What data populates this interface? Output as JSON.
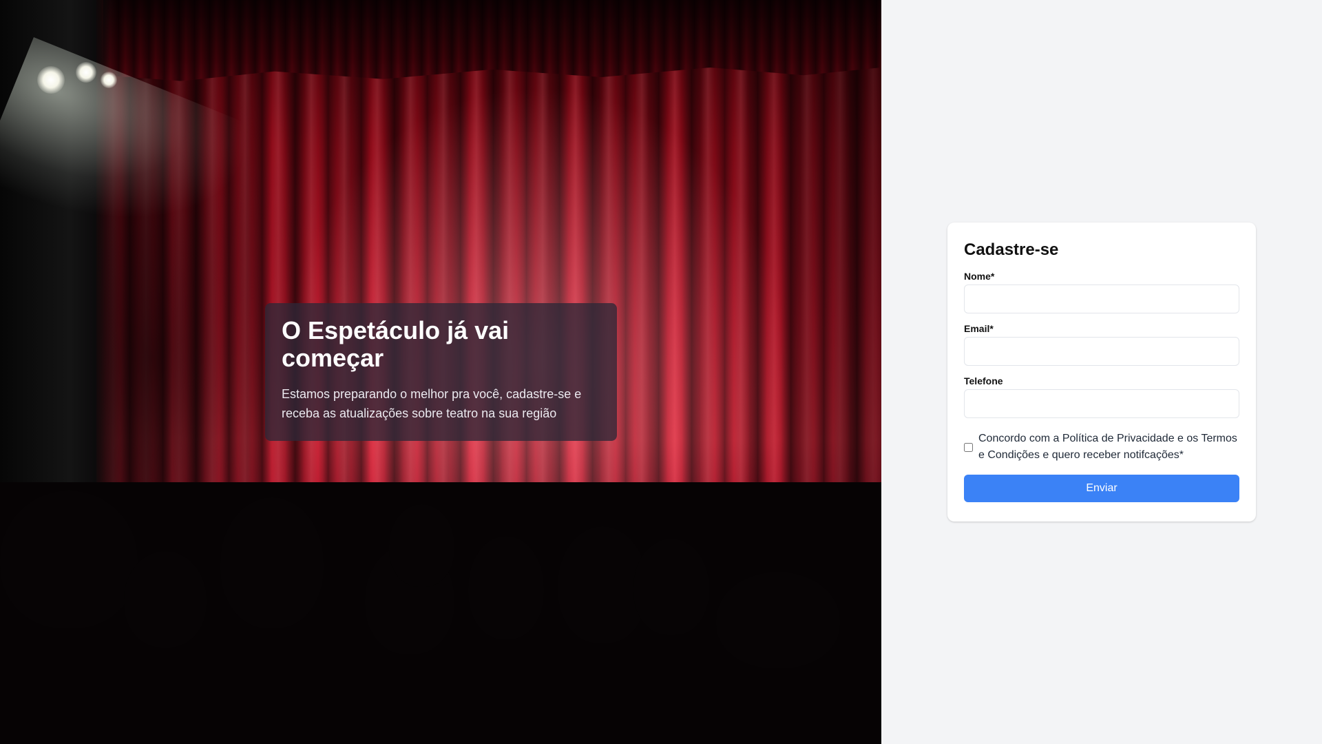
{
  "hero": {
    "title": "O Espetáculo já vai começar",
    "subtitle": "Estamos preparando o melhor pra você, cadastre-se e receba as atualizações sobre teatro na sua região"
  },
  "form": {
    "title": "Cadastre-se",
    "fields": [
      {
        "label": "Nome*",
        "value": "",
        "placeholder": ""
      },
      {
        "label": "Email*",
        "value": "",
        "placeholder": ""
      },
      {
        "label": "Telefone",
        "value": "",
        "placeholder": ""
      }
    ],
    "consent": {
      "label": "Concordo com a Política de Privacidade e os Termos e Condições e quero receber notifcações*",
      "checked": false
    },
    "submit_label": "Enviar"
  },
  "colors": {
    "accent": "#3b82f6",
    "side_background": "#f3f4f6",
    "card_background": "#ffffff",
    "curtain_red": "#c0162a"
  }
}
